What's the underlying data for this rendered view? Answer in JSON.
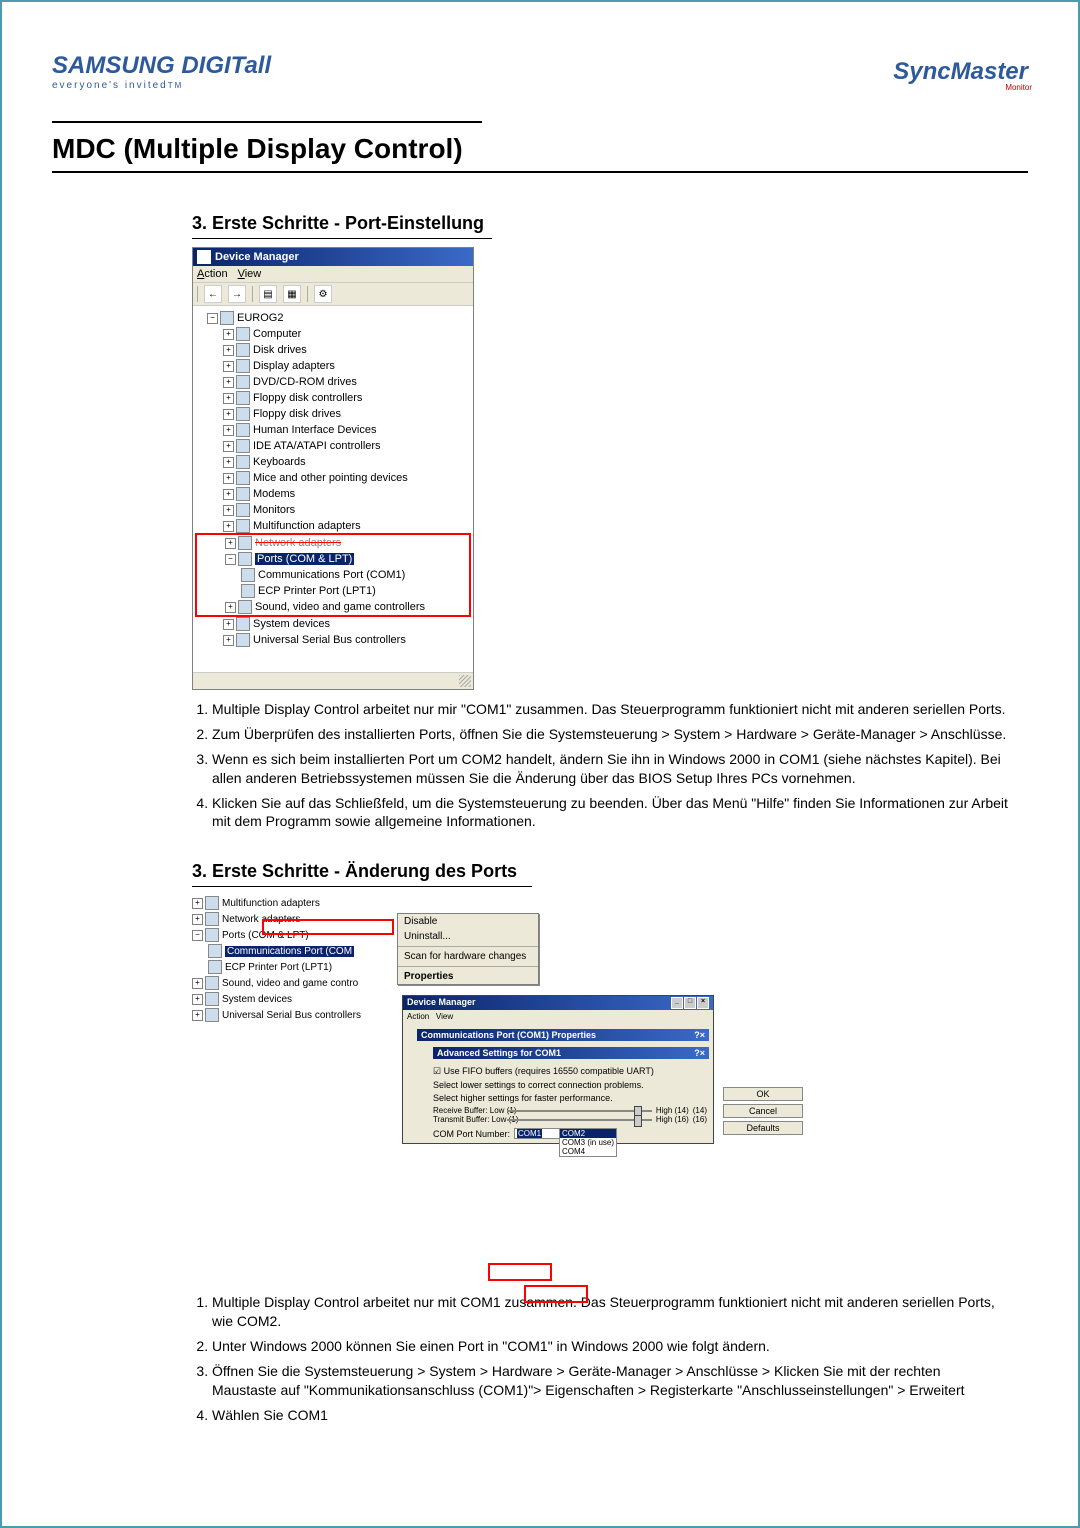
{
  "header": {
    "logo_main": "SAMSUNG DIGITall",
    "logo_tagline": "everyone's invited",
    "logo_tm": "TM",
    "right_logo": "SyncMaster",
    "right_sub": "Monitor"
  },
  "main_title": "MDC (Multiple Display Control)",
  "section1": {
    "title": "3. Erste Schritte - Port-Einstellung",
    "dm": {
      "title": "Device Manager",
      "menu_action": "Action",
      "menu_view": "View",
      "tb_back": "←",
      "tb_fwd": "→",
      "root": "EUROG2",
      "nodes": [
        "Computer",
        "Disk drives",
        "Display adapters",
        "DVD/CD-ROM drives",
        "Floppy disk controllers",
        "Floppy disk drives",
        "Human Interface Devices",
        "IDE ATA/ATAPI controllers",
        "Keyboards",
        "Mice and other pointing devices",
        "Modems",
        "Monitors",
        "Multifunction adapters"
      ],
      "struck": "Network adapters",
      "ports_label": "Ports (COM & LPT)",
      "com1": "Communications Port (COM1)",
      "lpt1": "ECP Printer Port (LPT1)",
      "after": [
        "Sound, video and game controllers",
        "System devices",
        "Universal Serial Bus controllers"
      ]
    },
    "steps": [
      "Multiple Display Control arbeitet nur mir \"COM1\" zusammen. Das Steuerprogramm funktioniert nicht mit anderen seriellen Ports.",
      "Zum Überprüfen des installierten Ports, öffnen Sie die Systemsteuerung > System > Hardware > Geräte-Manager > Anschlüsse.",
      "Wenn es sich beim installierten Port um COM2 handelt, ändern Sie ihn in Windows 2000 in COM1 (siehe nächstes Kapitel). Bei allen anderen Betriebssystemen müssen Sie die Änderung über das BIOS Setup Ihres PCs vornehmen.",
      "Klicken Sie auf das Schließfeld, um die Systemsteuerung zu beenden. Über das Menü \"Hilfe\" finden Sie Informationen zur Arbeit mit dem Programm sowie allgemeine Informationen."
    ]
  },
  "section2": {
    "title": "3. Erste Schritte - Änderung des Ports",
    "tree": {
      "multifunction": "Multifunction adapters",
      "network": "Network adapters",
      "ports": "Ports (COM & LPT)",
      "com": "Communications Port (COM",
      "lpt": "ECP Printer Port (LPT1)",
      "sound": "Sound, video and game contro",
      "system": "System devices",
      "usb": "Universal Serial Bus controllers"
    },
    "menu": {
      "disable": "Disable",
      "uninstall": "Uninstall...",
      "scan": "Scan for hardware changes",
      "properties": "Properties"
    },
    "adv": {
      "outer_title": "Device Manager",
      "inner_title_prop": "Communications Port (COM1) Properties",
      "inner_title": "Advanced Settings for COM1",
      "check": "Use FIFO buffers (requires 16550 compatible UART)",
      "line1": "Select lower settings to correct connection problems.",
      "line2": "Select higher settings for faster performance.",
      "rx_label": "Receive Buffer:  Low (1)",
      "rx_high": "High (14)",
      "rx_val": "(14)",
      "tx_label": "Transmit Buffer:  Low (1)",
      "tx_high": "High (16)",
      "tx_val": "(16)",
      "comport_label": "COM Port Number:",
      "combo_val": "COM1",
      "opt1": "COM2",
      "opt2": "COM3 (in use)",
      "opt3": "COM4",
      "btn_ok": "OK",
      "btn_cancel": "Cancel",
      "btn_defaults": "Defaults"
    },
    "steps": [
      "Multiple Display Control arbeitet nur mit COM1 zusammen. Das Steuerprogramm funktioniert nicht mit anderen seriellen Ports, wie COM2.",
      "Unter Windows 2000 können Sie einen Port in \"COM1\" in Windows 2000 wie folgt ändern.",
      "Öffnen Sie die Systemsteuerung > System > Hardware > Geräte-Manager > Anschlüsse > Klicken Sie mit der rechten Maustaste auf \"Kommunikationsanschluss (COM1)\"> Eigenschaften > Registerkarte \"Anschlusseinstellungen\" > Erweitert",
      "Wählen Sie COM1"
    ]
  }
}
